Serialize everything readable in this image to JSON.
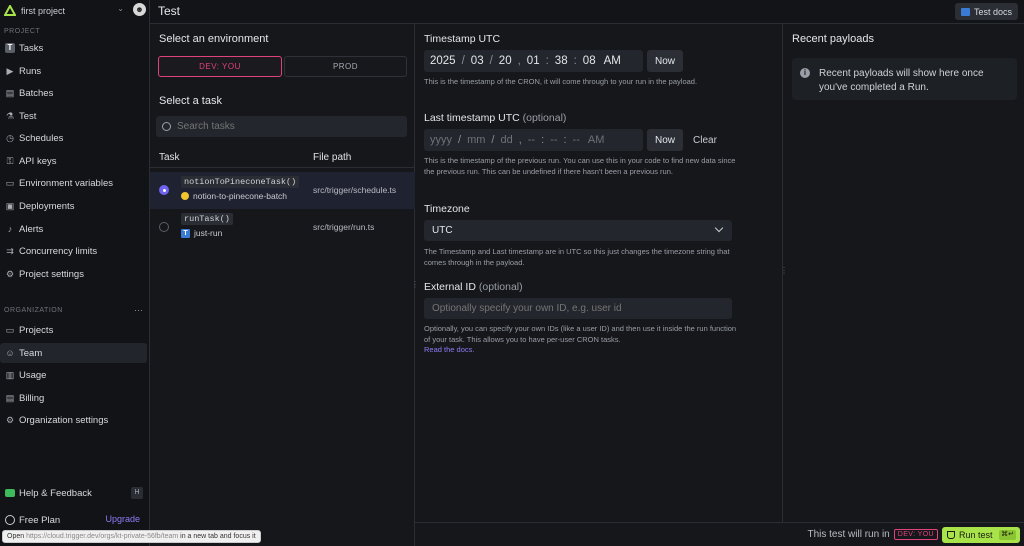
{
  "project": {
    "name": "first project",
    "avatar": "☻"
  },
  "sidebar": {
    "project_section": "PROJECT",
    "project_items": [
      {
        "label": "Tasks",
        "icon": "T"
      },
      {
        "label": "Runs",
        "icon": "▶"
      },
      {
        "label": "Batches",
        "icon": "▤"
      },
      {
        "label": "Test",
        "icon": "⚗"
      },
      {
        "label": "Schedules",
        "icon": "◷"
      },
      {
        "label": "API keys",
        "icon": "⚿"
      },
      {
        "label": "Environment variables",
        "icon": "▭"
      },
      {
        "label": "Deployments",
        "icon": "▣"
      },
      {
        "label": "Alerts",
        "icon": "♪"
      },
      {
        "label": "Concurrency limits",
        "icon": "⇉"
      },
      {
        "label": "Project settings",
        "icon": "⚙"
      }
    ],
    "org_section": "ORGANIZATION",
    "org_items": [
      {
        "label": "Projects",
        "icon": "▭"
      },
      {
        "label": "Team",
        "icon": "☺"
      },
      {
        "label": "Usage",
        "icon": "▥"
      },
      {
        "label": "Billing",
        "icon": "▤"
      },
      {
        "label": "Organization settings",
        "icon": "⚙"
      }
    ],
    "help": {
      "label": "Help & Feedback",
      "key": "H"
    },
    "plan": {
      "label": "Free Plan",
      "upgrade": "Upgrade"
    }
  },
  "status_url": {
    "prefix": "Open ",
    "url": "https://cloud.trigger.dev/orgs/kt-private-56fb/team",
    "suffix": " in a new tab and focus it"
  },
  "header": {
    "title": "Test",
    "docs_button": "Test docs"
  },
  "left": {
    "env_heading": "Select an environment",
    "env_dev": "DEV: YOU",
    "env_prod": "PROD",
    "task_heading": "Select a task",
    "search_placeholder": "Search tasks",
    "col_task": "Task",
    "col_path": "File path",
    "rows": [
      {
        "fn": "notionToPineconeTask()",
        "id": "notion-to-pinecone-batch",
        "path": "src/trigger/schedule.ts"
      },
      {
        "fn": "runTask()",
        "id": "just-run",
        "path": "src/trigger/run.ts"
      }
    ]
  },
  "form": {
    "ts_label": "Timestamp UTC",
    "ts": {
      "year": "2025",
      "month": "03",
      "day": "20",
      "hour": "01",
      "minute": "38",
      "second": "08",
      "ampm": "AM"
    },
    "now": "Now",
    "ts_help": "This is the timestamp of the CRON, it will come through to your run in the payload.",
    "last_label": "Last timestamp UTC",
    "optional": "(optional)",
    "last": {
      "year": "yyyy",
      "month": "mm",
      "day": "dd",
      "hour": "--",
      "minute": "--",
      "second": "--",
      "ampm": "AM"
    },
    "clear": "Clear",
    "last_help": "This is the timestamp of the previous run. You can use this in your code to find new data since the previous run. This can be undefined if there hasn't been a previous run.",
    "tz_label": "Timezone",
    "tz_value": "UTC",
    "tz_help": "The Timestamp and Last timestamp are in UTC so this just changes the timezone string that comes through in the payload.",
    "ext_label": "External ID",
    "ext_placeholder": "Optionally specify your own ID, e.g. user id",
    "ext_help": "Optionally, you can specify your own IDs (like a user ID) and then use it inside the run function of your task. This allows you to have per-user CRON tasks.",
    "docs_link": "Read the docs."
  },
  "right": {
    "heading": "Recent payloads",
    "info": "Recent payloads will show here once you've completed a Run."
  },
  "footer": {
    "will_run": "This test will run in",
    "env": "DEV: YOU",
    "run": "Run test",
    "run_key": "⌘↵"
  }
}
